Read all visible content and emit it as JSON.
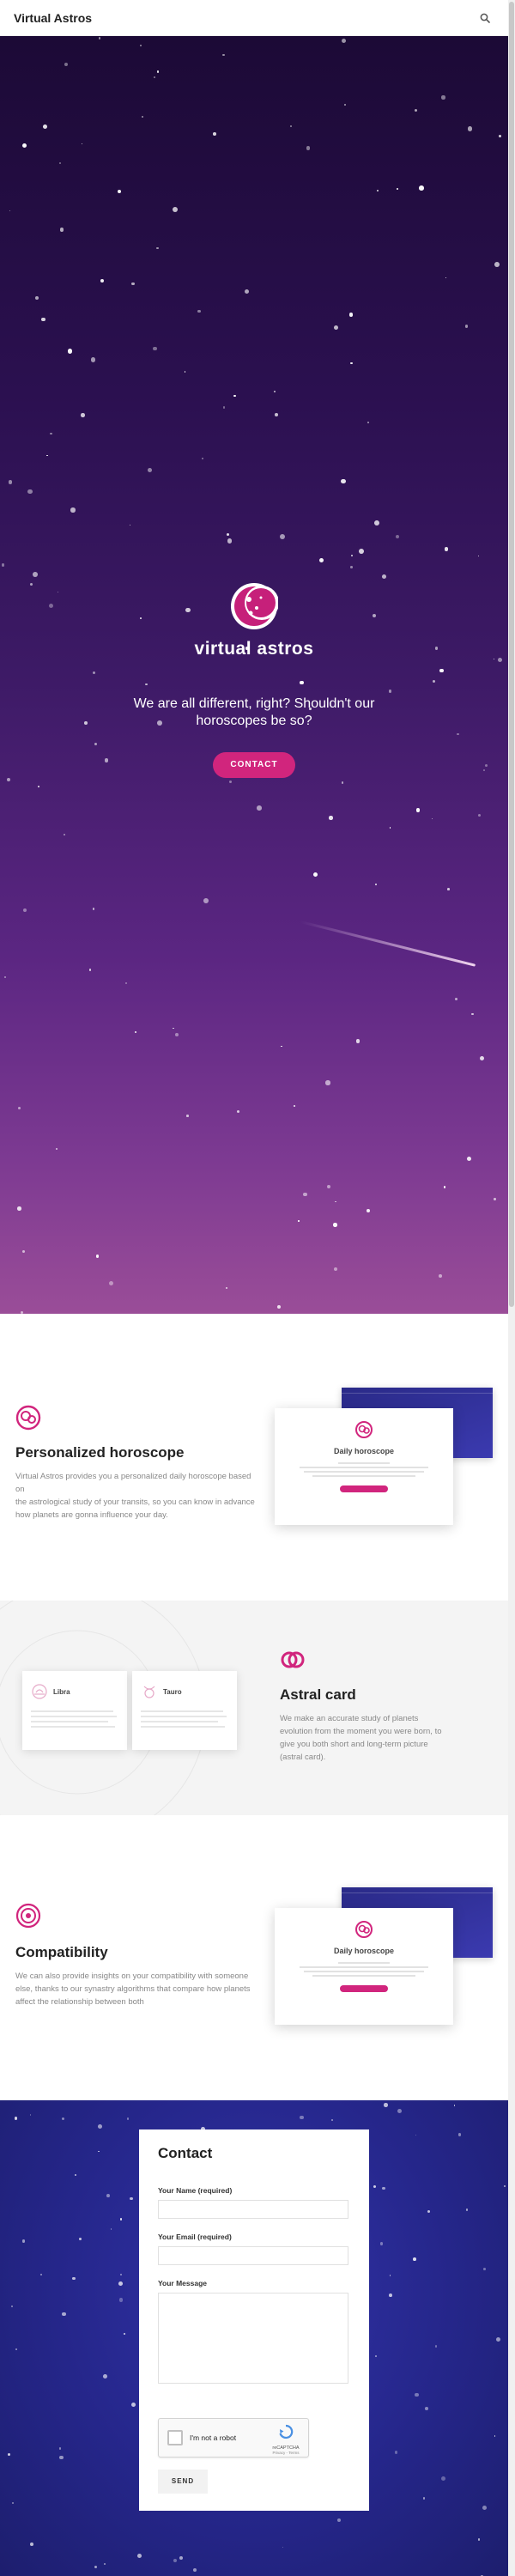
{
  "header": {
    "brand": "Virtual Astros",
    "search_icon": "search-icon"
  },
  "hero": {
    "logo_text": "virtual astros",
    "tagline_line1": "We are all different, right? Shouldn't our",
    "tagline_line2": "horoscopes be so?",
    "cta_label": "CONTACT"
  },
  "features": [
    {
      "icon": "horoscope-icon",
      "title": "Personalized horoscope",
      "text_lines": [
        "Virtual Astros provides you a personalized daily horoscope based on",
        "the astrological study of your transits, so you can know in advance",
        "how planets are gonna influence your day."
      ],
      "mockup": {
        "title": "Daily horoscope"
      }
    },
    {
      "icon": "rings-icon",
      "title": "Astral card",
      "text_lines": [
        "We make an accurate study of planets",
        "evolution from the moment you were born, to",
        "give you both short and long-term picture",
        "(astral card)."
      ],
      "cards": [
        {
          "name": "Libra"
        },
        {
          "name": "Tauro"
        }
      ]
    },
    {
      "icon": "compatibility-icon",
      "title": "Compatibility",
      "text_lines": [
        "We can also provide insights on your compatibility with someone",
        "else, thanks to our synastry algorithms that compare how planets",
        "affect the relationship between both"
      ],
      "mockup": {
        "title": "Daily horoscope"
      }
    }
  ],
  "contact": {
    "title": "Contact",
    "name_label": "Your Name (required)",
    "email_label": "Your Email (required)",
    "message_label": "Your Message",
    "captcha_label": "I'm not a robot",
    "captcha_brand": "reCAPTCHA",
    "captcha_terms": "Privacy - Terms",
    "send_label": "SEND"
  },
  "colors": {
    "accent": "#d1257d",
    "hero_top": "#1c0a36",
    "hero_bottom": "#9a4d98",
    "contact_bg": "#25268a"
  }
}
